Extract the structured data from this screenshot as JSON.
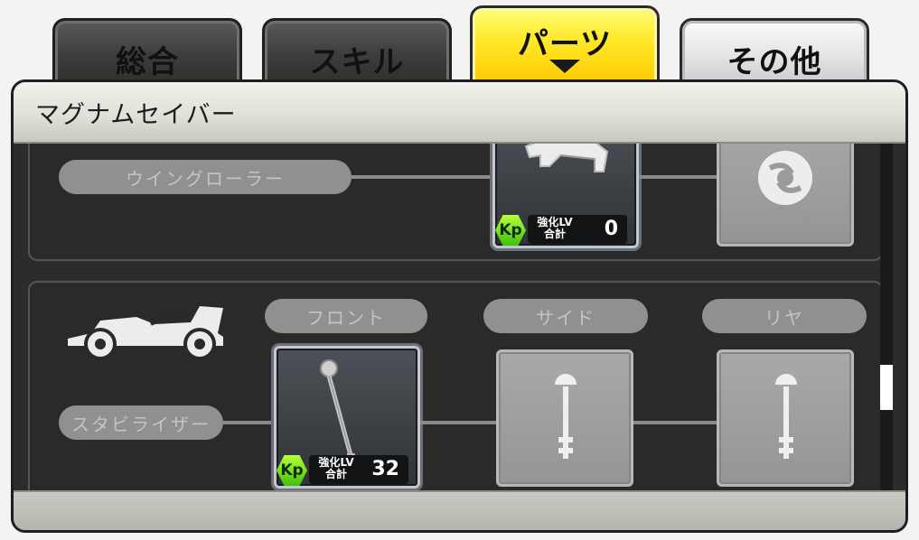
{
  "tabs": [
    {
      "label": "総合",
      "state": "inactive"
    },
    {
      "label": "スキル",
      "state": "inactive"
    },
    {
      "label": "パーツ",
      "state": "active"
    },
    {
      "label": "その他",
      "state": "inactive"
    }
  ],
  "panel": {
    "title": "マグナムセイバー"
  },
  "sections": {
    "roller": {
      "category_label": "ウイングローラー",
      "front_slot": {
        "badge": "Kp",
        "lv_label_1": "強化LV",
        "lv_label_2": "合計",
        "lv_value": "0",
        "icon": "wing-roller-part-icon"
      },
      "rear_slot": {
        "icon": "roller-wheel-icon"
      }
    },
    "stabilizer": {
      "category_label": "スタビライザー",
      "position_labels": [
        "フロント",
        "サイド",
        "リヤ"
      ],
      "front_slot": {
        "badge": "Kp",
        "lv_label_1": "強化LV",
        "lv_label_2": "合計",
        "lv_value": "32",
        "icon": "stabilizer-pole-icon"
      },
      "side_slot": {
        "icon": "stabilizer-placeholder-icon"
      },
      "rear_slot": {
        "icon": "stabilizer-placeholder-icon"
      },
      "car_icon": "race-car-icon"
    }
  },
  "colors": {
    "active_tab": "#ffe92a",
    "kp_badge": "#5ad414",
    "panel_bg": "#2c2c2c"
  }
}
